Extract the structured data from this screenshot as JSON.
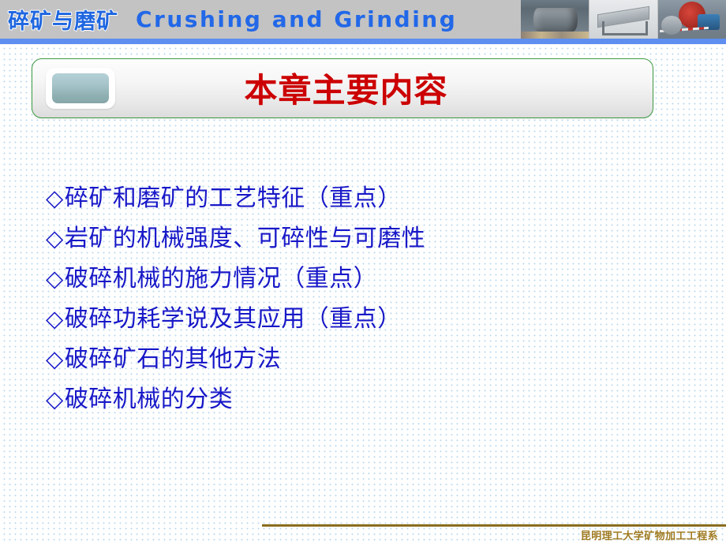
{
  "header": {
    "title_cn": "碎矿与磨矿",
    "title_en": "Crushing  and  Grinding",
    "background_color": "#c3c3c3",
    "accent_bar_color": "#5d8ef0",
    "title_cn_color": "#1f66e0",
    "title_en_color": "#2268e8",
    "photos": [
      {
        "name": "ball-mill-photo",
        "caption": "ball mill in plant"
      },
      {
        "name": "vibrating-screen-photo",
        "caption": "vibrating screen"
      },
      {
        "name": "crusher-photo",
        "caption": "crusher with red flywheel"
      }
    ]
  },
  "title_box": {
    "heading": "本章主要内容",
    "heading_color": "#cc0000",
    "border_color": "#3f9b45",
    "icon_name": "rounded-square-badge-icon",
    "icon_color": "#a6c5cb"
  },
  "content": {
    "bullet_mark": "◇",
    "text_color": "#1818c8",
    "items": [
      "碎矿和磨矿的工艺特征（重点）",
      "岩矿的机械强度、可碎性与可磨性",
      "破碎机械的施力情况（重点）",
      "破碎功耗学说及其应用（重点）",
      "破碎矿石的其他方法",
      "破碎机械的分类"
    ]
  },
  "footer": {
    "text": "昆明理工大学矿物加工工程系",
    "text_color": "#a07b22",
    "rule_color": "#8a6d1f"
  }
}
